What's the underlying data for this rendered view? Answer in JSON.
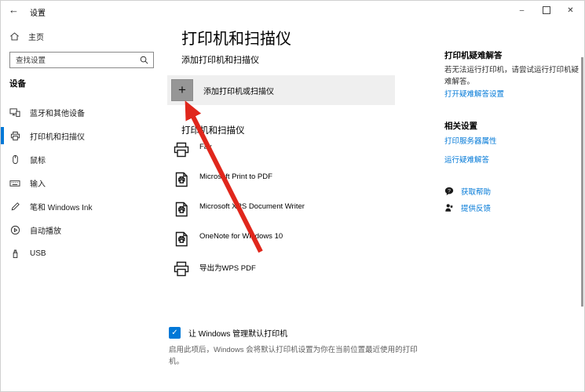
{
  "titlebar": {
    "app_title": "设置",
    "back_icon": "←",
    "minimize_icon": "–",
    "close_icon": "✕"
  },
  "sidebar": {
    "home_label": "主页",
    "search_placeholder": "查找设置",
    "section_heading": "设备",
    "items": [
      {
        "label": "蓝牙和其他设备",
        "selected": false
      },
      {
        "label": "打印机和扫描仪",
        "selected": true
      },
      {
        "label": "鼠标",
        "selected": false
      },
      {
        "label": "输入",
        "selected": false
      },
      {
        "label": "笔和 Windows Ink",
        "selected": false
      },
      {
        "label": "自动播放",
        "selected": false
      },
      {
        "label": "USB",
        "selected": false
      }
    ]
  },
  "main": {
    "page_title": "打印机和扫描仪",
    "add_section_heading": "添加打印机和扫描仪",
    "add_button_label": "添加打印机或扫描仪",
    "plus_icon": "+",
    "printers_section_heading": "打印机和扫描仪",
    "printers": [
      {
        "name": "Fax"
      },
      {
        "name": "Microsoft Print to PDF"
      },
      {
        "name": "Microsoft XPS Document Writer"
      },
      {
        "name": "OneNote for Windows 10"
      },
      {
        "name": "导出为WPS PDF"
      }
    ],
    "default_printer_setting": {
      "checked": true,
      "check_icon": "✓",
      "label": "让 Windows 管理默认打印机",
      "description": "启用此项后，Windows 会将默认打印机设置为你在当前位置最近使用的打印机。"
    }
  },
  "right_panel": {
    "troubleshoot_heading": "打印机疑难解答",
    "troubleshoot_body": "若无法运行打印机，请尝试运行打印机疑难解答。",
    "troubleshoot_link": "打开疑难解答设置",
    "related_heading": "相关设置",
    "related_links": [
      "打印服务器属性",
      "运行疑难解答"
    ],
    "help_links": [
      {
        "label": "获取帮助"
      },
      {
        "label": "提供反馈"
      }
    ]
  },
  "colors": {
    "accent": "#0078d7",
    "link": "#0078d7",
    "annotation_arrow": "#e0271c",
    "add_row_bg": "#efefef",
    "plus_button_bg": "#969696"
  }
}
